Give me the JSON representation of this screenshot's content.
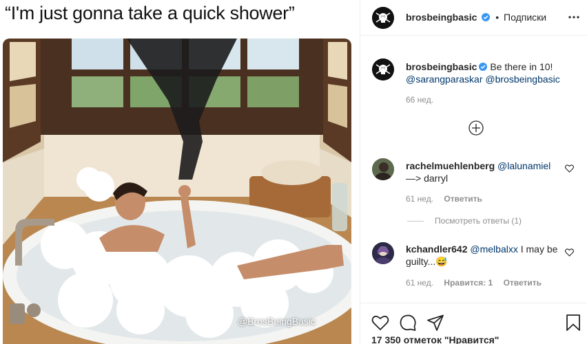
{
  "post": {
    "meme_caption": "“I'm just gonna take a quick shower”",
    "watermark": "@BrosBeingBasic"
  },
  "header": {
    "username": "brosbeingbasic",
    "dot": "•",
    "follow_label": "Подписки"
  },
  "caption": {
    "username": "brosbeingbasic",
    "text": "Be there in 10!",
    "mention1": "@sarangparaskar",
    "mention2": "@brosbeingbasic",
    "time": "66 нед."
  },
  "comments": [
    {
      "username": "rachelmuehlenberg",
      "mention": "@lalunamiel",
      "text": "—> darryl",
      "time": "61 нед.",
      "reply_label": "Ответить",
      "view_replies": "Посмотреть ответы (1)"
    },
    {
      "username": "kchandler642",
      "mention": "@melbalxx",
      "text": "I may be guilty...😅",
      "time": "61 нед.",
      "likes_label": "Нравится: 1",
      "reply_label": "Ответить"
    }
  ],
  "footer": {
    "likes_text": "17 350 отметок \"Нравится\""
  },
  "icons": [
    "more-options-icon",
    "verified-badge-icon",
    "load-more-comments-icon",
    "heart-icon",
    "comment-icon",
    "share-icon",
    "bookmark-icon"
  ],
  "colors": {
    "link": "#00376b",
    "verified": "#3897f0",
    "muted": "#8e8e8e",
    "border": "#efefef"
  }
}
